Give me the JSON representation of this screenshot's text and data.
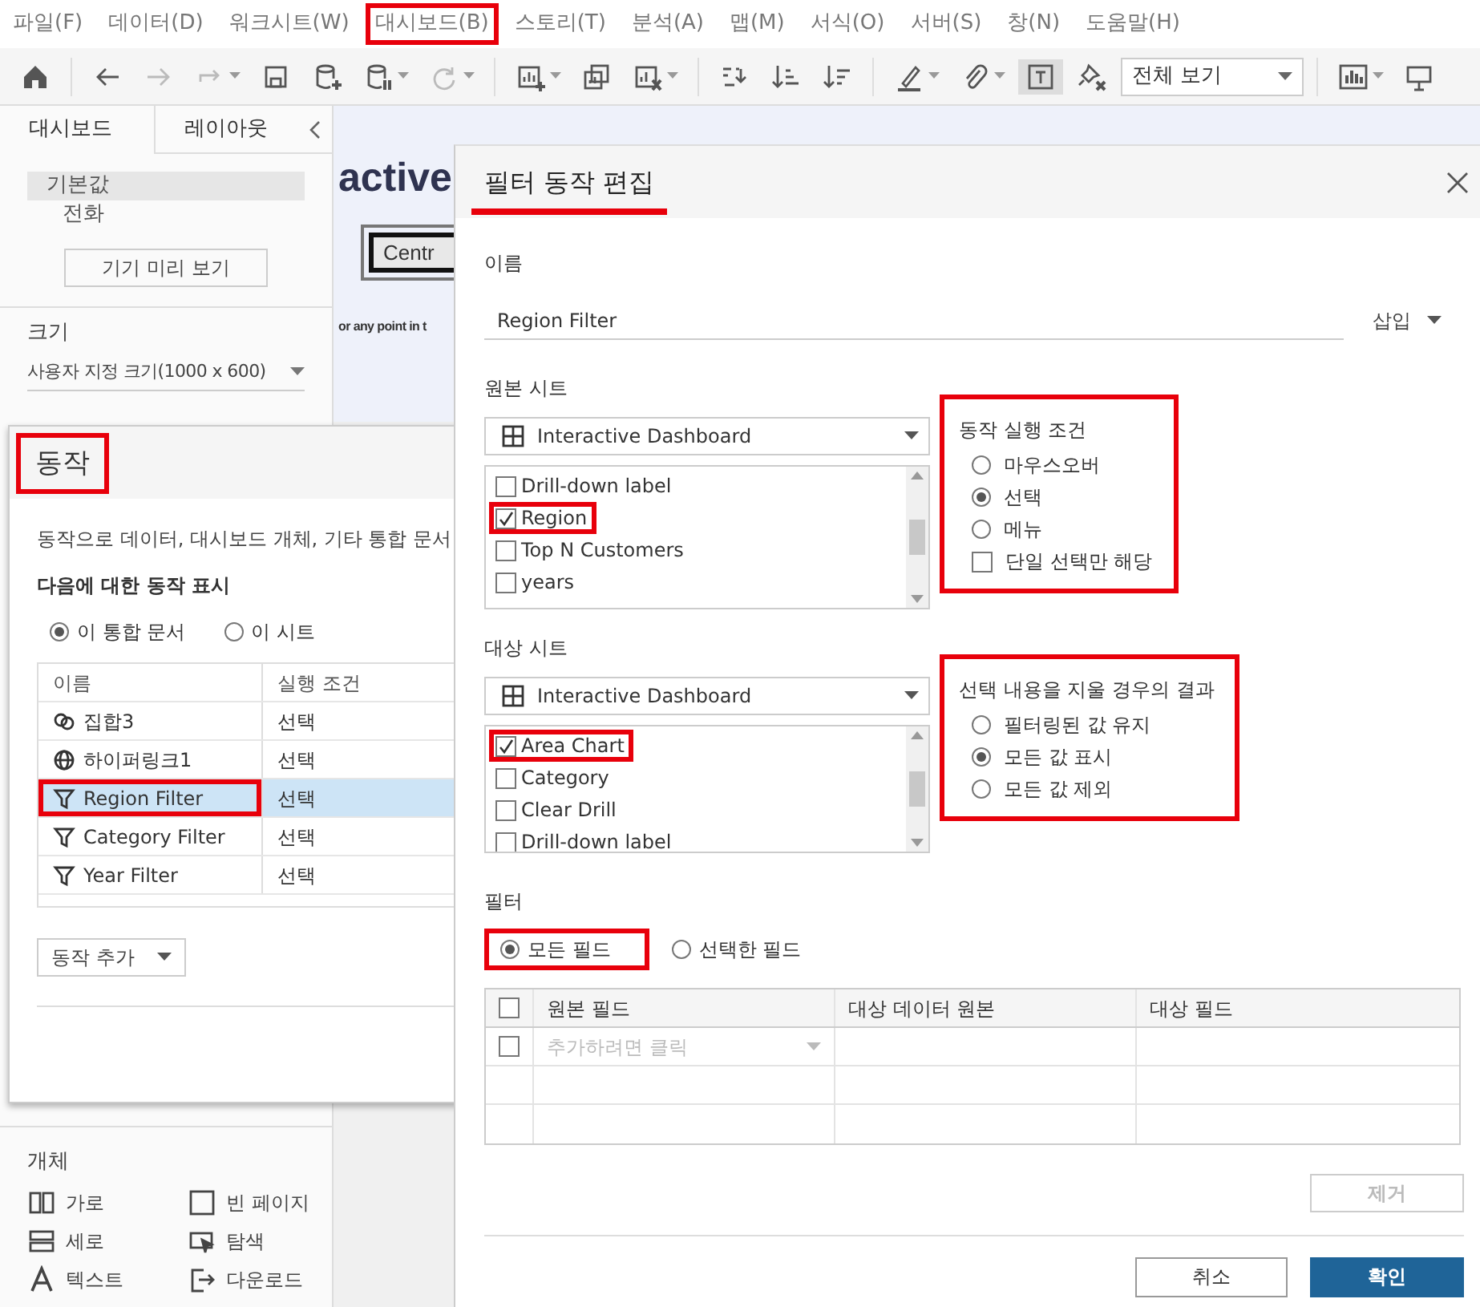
{
  "menu": [
    {
      "label": "파일(F)",
      "highlighted": false
    },
    {
      "label": "데이터(D)",
      "highlighted": false
    },
    {
      "label": "워크시트(W)",
      "highlighted": false
    },
    {
      "label": "대시보드(B)",
      "highlighted": true
    },
    {
      "label": "스토리(T)",
      "highlighted": false
    },
    {
      "label": "분석(A)",
      "highlighted": false
    },
    {
      "label": "맵(M)",
      "highlighted": false
    },
    {
      "label": "서식(O)",
      "highlighted": false
    },
    {
      "label": "서버(S)",
      "highlighted": false
    },
    {
      "label": "창(N)",
      "highlighted": false
    },
    {
      "label": "도움말(H)",
      "highlighted": false
    }
  ],
  "toolbar": [
    [
      {
        "kind": "home",
        "disabled": false,
        "pressed": false,
        "has_menu": false
      }
    ],
    [
      {
        "kind": "back",
        "disabled": false,
        "pressed": false,
        "has_menu": false
      },
      {
        "kind": "forward",
        "disabled": true,
        "pressed": false,
        "has_menu": false
      },
      {
        "kind": "redo",
        "disabled": true,
        "pressed": false,
        "has_menu": true
      },
      {
        "kind": "save",
        "disabled": false,
        "pressed": false,
        "has_menu": false
      },
      {
        "kind": "add-data",
        "disabled": false,
        "pressed": false,
        "has_menu": false
      },
      {
        "kind": "pause-data",
        "disabled": false,
        "pressed": false,
        "has_menu": true
      },
      {
        "kind": "refresh",
        "disabled": true,
        "pressed": false,
        "has_menu": true
      }
    ],
    [
      {
        "kind": "new-sheet",
        "disabled": false,
        "pressed": false,
        "has_menu": true
      },
      {
        "kind": "duplicate",
        "disabled": false,
        "pressed": false,
        "has_menu": false
      },
      {
        "kind": "clear-sheet",
        "disabled": false,
        "pressed": false,
        "has_menu": true
      }
    ],
    [
      {
        "kind": "swap",
        "disabled": false,
        "pressed": false,
        "has_menu": false
      },
      {
        "kind": "sort-asc",
        "disabled": false,
        "pressed": false,
        "has_menu": false
      },
      {
        "kind": "sort-desc",
        "disabled": false,
        "pressed": false,
        "has_menu": false
      }
    ],
    [
      {
        "kind": "highlight",
        "disabled": false,
        "pressed": false,
        "has_menu": true
      },
      {
        "kind": "attach",
        "disabled": false,
        "pressed": false,
        "has_menu": true
      },
      {
        "kind": "text",
        "disabled": false,
        "pressed": true,
        "has_menu": false
      },
      {
        "kind": "unpin",
        "disabled": false,
        "pressed": false,
        "has_menu": false
      },
      {
        "kind": "select",
        "value": "전체 보기"
      }
    ],
    [
      {
        "kind": "show-me",
        "disabled": false,
        "pressed": false,
        "has_menu": true
      },
      {
        "kind": "present",
        "disabled": false,
        "pressed": false,
        "has_menu": false
      }
    ]
  ],
  "left_panel": {
    "tabs": [
      {
        "label": "대시보드",
        "selected": true
      },
      {
        "label": "레이아웃",
        "selected": false
      }
    ],
    "devices": [
      {
        "label": "기본값",
        "selected": true,
        "children": [
          {
            "label": "전화",
            "selected": false
          }
        ]
      }
    ],
    "preview_button": "기기 미리 보기",
    "size_label": "크기",
    "size_value": "사용자 지정 크기(1000 x 600)",
    "objects_title": "개체",
    "objects": [
      {
        "kind": "horizontal",
        "label": "가로"
      },
      {
        "kind": "blank",
        "label": "빈 페이지"
      },
      {
        "kind": "vertical",
        "label": "세로"
      },
      {
        "kind": "navigation",
        "label": "탐색"
      },
      {
        "kind": "text",
        "label": "텍스트"
      },
      {
        "kind": "download",
        "label": "다운로드"
      }
    ]
  },
  "canvas": {
    "title": "active",
    "button": "Centr",
    "note": "or any point in t"
  },
  "actions_dialog": {
    "title": "동작",
    "title_highlighted": true,
    "description": "동작으로 데이터, 대시보드 개체, 기타 통합 문서",
    "show_for_label": "다음에 대한 동작 표시",
    "scope": [
      {
        "label": "이 통합 문서",
        "selected": true
      },
      {
        "label": "이 시트",
        "selected": false
      }
    ],
    "columns": [
      "이름",
      "실행 조건"
    ],
    "rows": [
      {
        "kind": "set",
        "name": "집합3",
        "trigger": "선택",
        "selected": false,
        "highlighted": false
      },
      {
        "kind": "link",
        "name": "하이퍼링크1",
        "trigger": "선택",
        "selected": false,
        "highlighted": false
      },
      {
        "kind": "filter",
        "name": "Region Filter",
        "trigger": "선택",
        "selected": true,
        "highlighted": true
      },
      {
        "kind": "filter",
        "name": "Category Filter",
        "trigger": "선택",
        "selected": false,
        "highlighted": false
      },
      {
        "kind": "filter",
        "name": "Year Filter",
        "trigger": "선택",
        "selected": false,
        "highlighted": false
      }
    ],
    "add_button": "동작 추가"
  },
  "filter_dialog": {
    "title": "필터 동작 편집",
    "title_highlighted": true,
    "name_label": "이름",
    "name_value": "Region Filter",
    "insert_button": "삽입",
    "source": {
      "label": "원본 시트",
      "sheet": "Interactive Dashboard",
      "sheets": [
        {
          "label": "Drill-down label",
          "checked": false,
          "highlighted": false
        },
        {
          "label": "Region",
          "checked": true,
          "highlighted": true
        },
        {
          "label": "Top N Customers",
          "checked": false,
          "highlighted": false
        },
        {
          "label": "years",
          "checked": false,
          "highlighted": false
        }
      ],
      "group": {
        "title": "동작 실행 조건",
        "highlighted": true,
        "options": [
          {
            "kind": "radio",
            "label": "마우스오버",
            "selected": false
          },
          {
            "kind": "radio",
            "label": "선택",
            "selected": true
          },
          {
            "kind": "radio",
            "label": "메뉴",
            "selected": false
          },
          {
            "kind": "checkbox",
            "label": "단일 선택만 해당",
            "checked": false
          }
        ]
      }
    },
    "target": {
      "label": "대상 시트",
      "sheet": "Interactive Dashboard",
      "sheets": [
        {
          "label": "Area Chart",
          "checked": true,
          "highlighted": true
        },
        {
          "label": "Category",
          "checked": false,
          "highlighted": false
        },
        {
          "label": "Clear Drill",
          "checked": false,
          "highlighted": false
        },
        {
          "label": "Drill-down label",
          "checked": false,
          "highlighted": false
        }
      ],
      "group": {
        "title": "선택 내용을 지울 경우의 결과",
        "highlighted": true,
        "options": [
          {
            "kind": "radio",
            "label": "필터링된 값 유지",
            "selected": false
          },
          {
            "kind": "radio",
            "label": "모든 값 표시",
            "selected": true
          },
          {
            "kind": "radio",
            "label": "모든 값 제외",
            "selected": false
          }
        ]
      }
    },
    "filters": {
      "label": "필터",
      "options": [
        {
          "label": "모든 필드",
          "selected": true,
          "highlighted": true
        },
        {
          "label": "선택한 필드",
          "selected": false,
          "highlighted": false
        }
      ],
      "select_all_checked": false,
      "columns": [
        "원본 필드",
        "대상 데이터 원본",
        "대상 필드"
      ],
      "rows": [
        {
          "placeholder": "추가하려면 클릭",
          "checked": false
        }
      ]
    },
    "remove_button": {
      "label": "제거",
      "disabled": true
    },
    "cancel_button": "취소",
    "ok_button": "확인"
  }
}
